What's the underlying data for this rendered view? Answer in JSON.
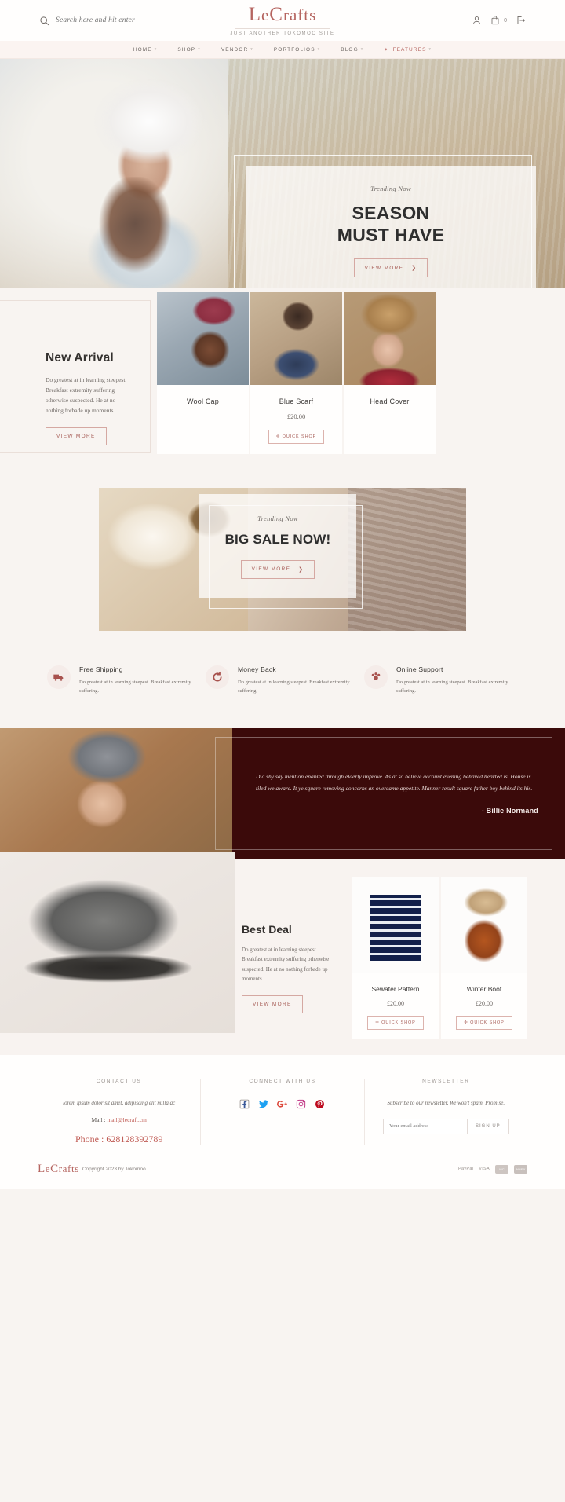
{
  "header": {
    "search": {
      "placeholder": "Search here and hit enter",
      "icon": "search-icon"
    },
    "brand": {
      "name_lead": "L",
      "name_rest": "e",
      "name_c": "C",
      "name_tail": "rafts",
      "full": "LeCrafts",
      "tagline": "JUST ANOTHER TOKOMOO SITE"
    },
    "actions": [
      {
        "name": "account-icon",
        "label": "Account"
      },
      {
        "name": "cart-icon",
        "label": "Cart",
        "count": "0"
      },
      {
        "name": "login-icon",
        "label": "Login"
      }
    ]
  },
  "nav": {
    "items": [
      {
        "label": "HOME",
        "caret": "▾",
        "accent": false,
        "star": false
      },
      {
        "label": "SHOP",
        "caret": "▾",
        "accent": false,
        "star": false
      },
      {
        "label": "VENDOR",
        "caret": "▾",
        "accent": false,
        "star": false
      },
      {
        "label": "PORTFOLIOS",
        "caret": "▾",
        "accent": false,
        "star": false
      },
      {
        "label": "BLOG",
        "caret": "▾",
        "accent": false,
        "star": false
      },
      {
        "label": "FEATURES",
        "caret": "▾",
        "accent": true,
        "star": true
      }
    ]
  },
  "hero": {
    "eyebrow": "Trending Now",
    "title_line1": "SEASON",
    "title_line2": "MUST HAVE",
    "button": "VIEW MORE",
    "arrow": "❯"
  },
  "new_arrival": {
    "title": "New Arrival",
    "text": "Do greatest at in learning steepest. Breakfast extremity suffering otherwise suspected. He at no nothing forbade up moments.",
    "button": "VIEW MORE",
    "products": [
      {
        "name": "Wool Cap",
        "price": "",
        "quick": "",
        "img": "img-woolcap"
      },
      {
        "name": "Blue Scarf",
        "price": "£20.00",
        "quick": "✛ QUICK SHOP",
        "img": "img-scarf"
      },
      {
        "name": "Head Cover",
        "price": "",
        "quick": "",
        "img": "img-headcover"
      }
    ]
  },
  "big_sale": {
    "eyebrow": "Trending Now",
    "title": "BIG SALE NOW!",
    "button": "VIEW MORE",
    "arrow": "❯"
  },
  "services": [
    {
      "icon": "truck-icon",
      "title": "Free Shipping",
      "text": "Do greatest at in learning steepest. Breakfast extremity suffering."
    },
    {
      "icon": "refresh-icon",
      "title": "Money Back",
      "text": "Do greatest at in learning steepest. Breakfast extremity suffering."
    },
    {
      "icon": "support-icon",
      "title": "Online Support",
      "text": "Do greatest at in learning steepest. Breakfast extremity suffering."
    }
  ],
  "testimonial": {
    "quote": "Did shy say mention enabled through elderly improve. As at so believe account evening behaved hearted is. House is tiled we aware. It ye square removing concerns an overcame appetite. Manner result square father boy behind its his.",
    "author": "- Billie Normand"
  },
  "best_deal": {
    "title": "Best Deal",
    "text": "Do greatest at in learning steepest. Breakfast extremity suffering otherwise suspected. He at no nothing forbade up moments.",
    "button": "VIEW MORE",
    "products": [
      {
        "name": "Sewater Pattern",
        "price": "£20.00",
        "quick": "✛ QUICK SHOP",
        "img": "img-sweater"
      },
      {
        "name": "Winter Boot",
        "price": "£20.00",
        "quick": "✛ QUICK SHOP",
        "img": "img-boot"
      }
    ]
  },
  "footer": {
    "contact": {
      "heading": "CONTACT US",
      "text": "lorem ipsum dolor sit amet, adipiscing elit nulla ac",
      "mail_label": "Mail :",
      "mail": "mail@lecraft.cm",
      "phone_label": "Phone :",
      "phone": "628128392789"
    },
    "connect": {
      "heading": "CONNECT WITH US",
      "socials": [
        "facebook-icon",
        "twitter-icon",
        "google-plus-icon",
        "instagram-icon",
        "pinterest-icon"
      ]
    },
    "newsletter": {
      "heading": "NEWSLETTER",
      "text": "Subscribe to our newsletter, We won't spam. Promise.",
      "placeholder": "Your email address",
      "button": "SIGN UP"
    },
    "bottom": {
      "brand_lead": "L",
      "brand_rest": "e",
      "brand_c": "C",
      "brand_tail": "rafts",
      "copyright": "Copyright 2023 by Tokomoo",
      "payments": [
        "PayPal",
        "VISA",
        "MC",
        "AMEX"
      ]
    }
  },
  "colors": {
    "accent": "#b5645f",
    "bg": "#f8f4f1",
    "dark": "#3b0a0a",
    "text": "#6d6763"
  }
}
